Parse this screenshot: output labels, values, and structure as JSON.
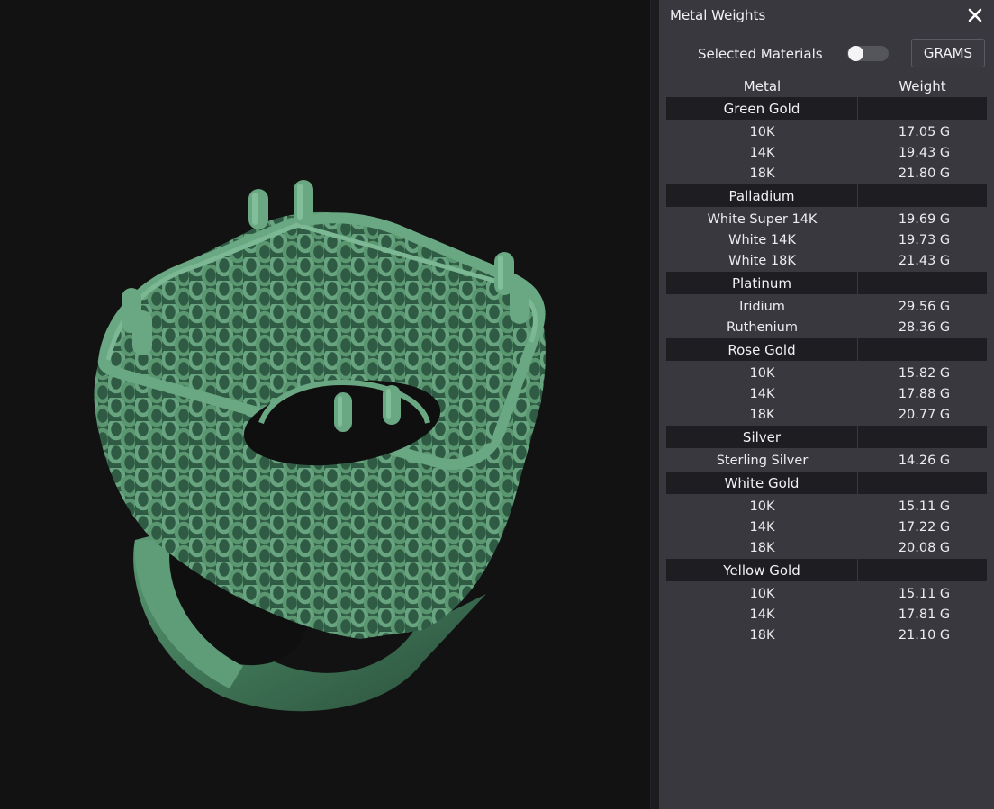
{
  "panel": {
    "title": "Metal Weights",
    "selected_materials_label": "Selected Materials",
    "selected_materials_on": false,
    "units_button": "GRAMS",
    "columns": [
      "Metal",
      "Weight"
    ],
    "groups": [
      {
        "name": "Green Gold",
        "rows": [
          {
            "metal": "10K",
            "weight": "17.05 G"
          },
          {
            "metal": "14K",
            "weight": "19.43 G"
          },
          {
            "metal": "18K",
            "weight": "21.80 G"
          }
        ]
      },
      {
        "name": "Palladium",
        "rows": [
          {
            "metal": "White Super 14K",
            "weight": "19.69 G"
          },
          {
            "metal": "White 14K",
            "weight": "19.73 G"
          },
          {
            "metal": "White 18K",
            "weight": "21.43 G"
          }
        ]
      },
      {
        "name": "Platinum",
        "rows": [
          {
            "metal": "Iridium",
            "weight": "29.56 G"
          },
          {
            "metal": "Ruthenium",
            "weight": "28.36 G"
          }
        ]
      },
      {
        "name": "Rose Gold",
        "rows": [
          {
            "metal": "10K",
            "weight": "15.82 G"
          },
          {
            "metal": "14K",
            "weight": "17.88 G"
          },
          {
            "metal": "18K",
            "weight": "20.77 G"
          }
        ]
      },
      {
        "name": "Silver",
        "rows": [
          {
            "metal": "Sterling Silver",
            "weight": "14.26 G"
          }
        ]
      },
      {
        "name": "White Gold",
        "rows": [
          {
            "metal": "10K",
            "weight": "15.11 G"
          },
          {
            "metal": "14K",
            "weight": "17.22 G"
          },
          {
            "metal": "18K",
            "weight": "20.08 G"
          }
        ]
      },
      {
        "name": "Yellow Gold",
        "rows": [
          {
            "metal": "10K",
            "weight": "15.11 G"
          },
          {
            "metal": "14K",
            "weight": "17.81 G"
          },
          {
            "metal": "18K",
            "weight": "21.10 G"
          }
        ]
      }
    ]
  },
  "icons": {
    "close": "close-icon"
  },
  "colors": {
    "viewport_bg": "#121212",
    "panel_bg": "#38383e",
    "group_header_bg": "#1e1e22",
    "model_green": "#4e8a66"
  }
}
